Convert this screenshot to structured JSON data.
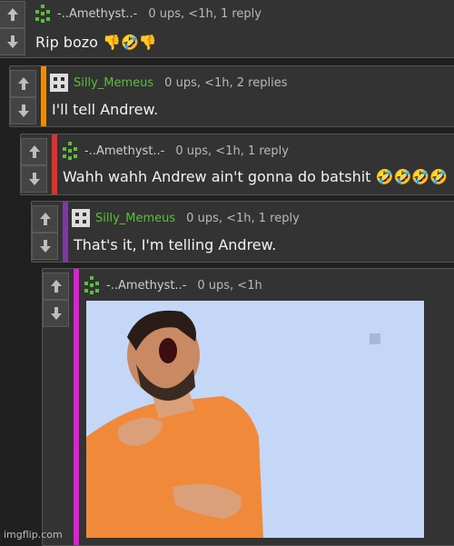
{
  "comments": [
    {
      "user": "-..Amethyst..-",
      "stats": "0 ups, <1h, 1 reply",
      "text": "Rip bozo 👎🤣👎"
    },
    {
      "user": "Silly_Memeus",
      "stats": "0 ups, <1h, 2 replies",
      "text": "I'll tell Andrew."
    },
    {
      "user": "-..Amethyst..-",
      "stats": "0 ups, <1h, 1 reply",
      "text": "Wahh wahh Andrew ain't gonna do batshit 🤣🤣🤣🤣"
    },
    {
      "user": "Silly_Memeus",
      "stats": "0 ups, <1h, 1 reply",
      "text": "That's it, I'm telling Andrew."
    },
    {
      "user": "-..Amethyst..-",
      "stats": "0 ups, <1h",
      "text": ""
    }
  ],
  "image_alt": "laughing man in orange t-shirt",
  "watermark": "imgflip.com",
  "colors": {
    "bar1": "#f08a00",
    "bar2": "#e03030",
    "bar3": "#7a3aa0",
    "bar4": "#e020d0",
    "username": "#5cbf3b"
  }
}
